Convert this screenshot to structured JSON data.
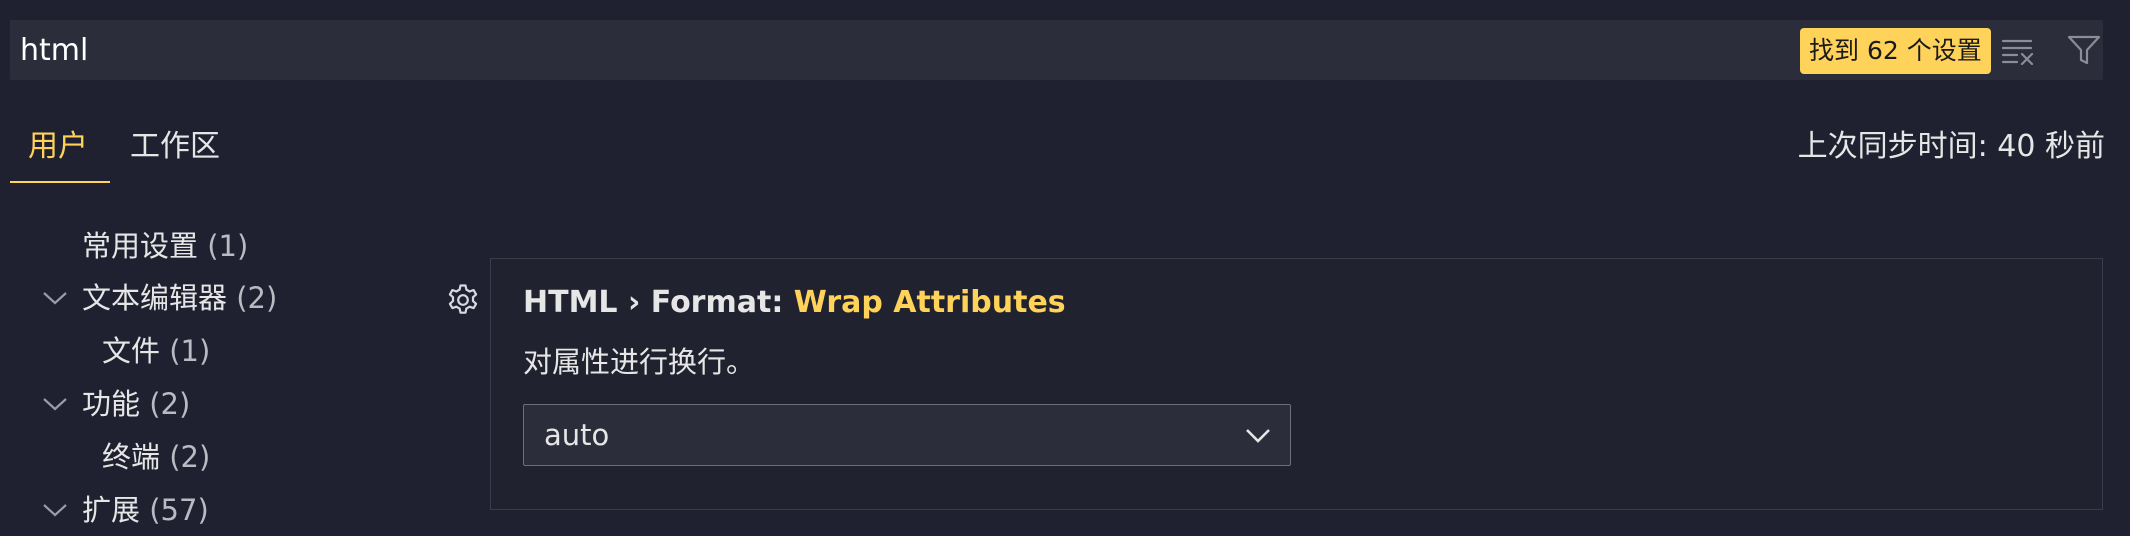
{
  "search": {
    "value": "html",
    "results_label": "找到 62 个设置",
    "clear_icon": "clear-filter-icon",
    "filter_icon": "filter-icon"
  },
  "tabs": [
    {
      "label": "用户",
      "active": true
    },
    {
      "label": "工作区",
      "active": false
    }
  ],
  "sync_status": "上次同步时间: 40 秒前",
  "toc": [
    {
      "label": "常用设置",
      "count": "(1)",
      "expanded": null
    },
    {
      "label": "文本编辑器",
      "count": "(2)",
      "expanded": true
    },
    {
      "label": "文件",
      "count": "(1)",
      "expanded": null
    },
    {
      "label": "功能",
      "count": "(2)",
      "expanded": true
    },
    {
      "label": "终端",
      "count": "(2)",
      "expanded": null
    },
    {
      "label": "扩展",
      "count": "(57)",
      "expanded": true
    }
  ],
  "setting": {
    "category": "HTML › Format: ",
    "name": "Wrap Attributes",
    "description": "对属性进行换行。",
    "value": "auto"
  },
  "colors": {
    "background": "#1f2130",
    "accent": "#ffd25a",
    "input_bg": "#2b2d3a"
  }
}
